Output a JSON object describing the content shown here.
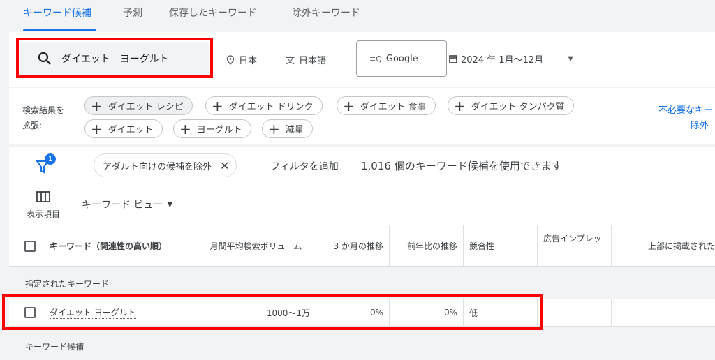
{
  "tabs": [
    {
      "label": "キーワード候補",
      "active": true
    },
    {
      "label": "予測"
    },
    {
      "label": "保存したキーワード"
    },
    {
      "label": "除外キーワード"
    }
  ],
  "search": {
    "icon": "search-icon",
    "value": "ダイエット　ヨーグルト"
  },
  "location": {
    "icon": "location-pin-icon",
    "label": "日本"
  },
  "language": {
    "icon": "translate-icon",
    "label": "日本語"
  },
  "network": {
    "icon": "search-network-icon",
    "label": "Google"
  },
  "date": {
    "icon": "calendar-icon",
    "label": "2024 年 1月〜12月"
  },
  "expand": {
    "label_line1": "検索結果を",
    "label_line2": "拡張:",
    "chips": [
      "ダイエット レシピ",
      "ダイエット ドリンク",
      "ダイエット 食事",
      "ダイエット タンパク質",
      "ダイエット",
      "ヨーグルト",
      "減量"
    ],
    "right_link_1": "不必要なキー",
    "right_link_2": "除外"
  },
  "filters": {
    "badge": "1",
    "chip": "アダルト向けの候補を除外",
    "add_filter": "フィルタを追加",
    "count_text": "1,016 個のキーワード候補を使用できます"
  },
  "columns_button": "表示項目",
  "view_select": "キーワード ビュー",
  "table": {
    "headers": [
      "キーワード（関連性の高い順）",
      "月間平均検索ボリューム",
      "3 か月の推移",
      "前年比の推移",
      "競合性",
      "広告インプレッ",
      "上部に掲載された"
    ],
    "section1": "指定されたキーワード",
    "rows": [
      {
        "keyword": "ダイエット ヨーグルト",
        "volume": "1000〜1万",
        "three_month": "0%",
        "yoy": "0%",
        "competition": "低",
        "impression": "–",
        "top": ""
      }
    ],
    "section2": "キーワード候補"
  },
  "colors": {
    "accent": "#1a73e8",
    "highlight": "#ff0000"
  }
}
